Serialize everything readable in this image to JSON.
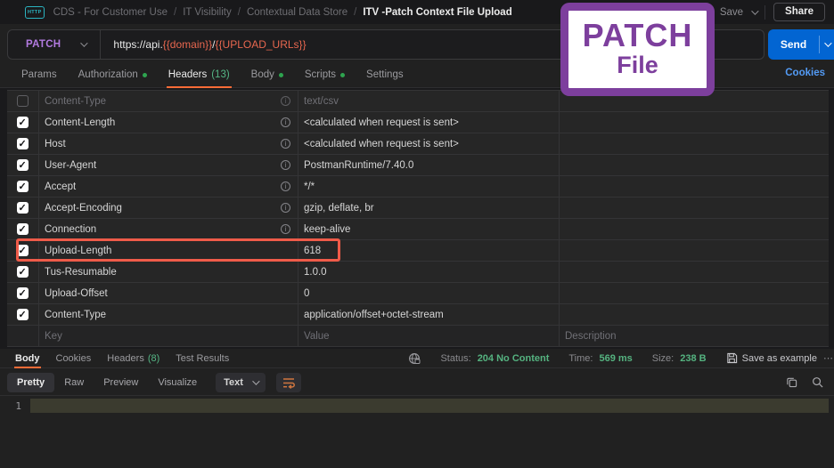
{
  "header": {
    "icon_label": "HTTP",
    "breadcrumb": [
      "CDS - For Customer Use",
      "IT Visibility",
      "Contextual Data Store",
      "ITV -Patch Context File Upload"
    ],
    "separator": "/",
    "save_label": "Save",
    "share_label": "Share"
  },
  "request": {
    "method": "PATCH",
    "url_parts": {
      "p0": "https://api.",
      "p1": "{{domain}}",
      "p2": "/",
      "p3": "{{UPLOAD_URLs}}"
    },
    "send_label": "Send"
  },
  "overlay": {
    "line1": "PATCH",
    "line2": "File"
  },
  "request_tabs": {
    "items": [
      {
        "label": "Params"
      },
      {
        "label": "Authorization"
      },
      {
        "label": "Headers",
        "count": "(13)"
      },
      {
        "label": "Body"
      },
      {
        "label": "Scripts"
      },
      {
        "label": "Settings"
      }
    ],
    "cookies_link": "Cookies"
  },
  "headers_table": {
    "info_glyph": "i",
    "rows": [
      {
        "key": "Content-Type",
        "value": "text/csv",
        "checked": false,
        "info": true,
        "dim": true
      },
      {
        "key": "Content-Length",
        "value": "<calculated when request is sent>",
        "checked": true,
        "info": true
      },
      {
        "key": "Host",
        "value": "<calculated when request is sent>",
        "checked": true,
        "info": true
      },
      {
        "key": "User-Agent",
        "value": "PostmanRuntime/7.40.0",
        "checked": true,
        "info": true
      },
      {
        "key": "Accept",
        "value": "*/*",
        "checked": true,
        "info": true
      },
      {
        "key": "Accept-Encoding",
        "value": "gzip, deflate, br",
        "checked": true,
        "info": true
      },
      {
        "key": "Connection",
        "value": "keep-alive",
        "checked": true,
        "info": true
      },
      {
        "key": "Upload-Length",
        "value": "618",
        "checked": true,
        "highlighted": true
      },
      {
        "key": "Tus-Resumable",
        "value": "1.0.0",
        "checked": true
      },
      {
        "key": "Upload-Offset",
        "value": "0",
        "checked": true
      },
      {
        "key": "Content-Type",
        "value": "application/offset+octet-stream",
        "checked": true
      }
    ],
    "placeholder": {
      "key": "Key",
      "value": "Value",
      "description": "Description"
    }
  },
  "response": {
    "tabs": [
      {
        "label": "Body"
      },
      {
        "label": "Cookies"
      },
      {
        "label": "Headers",
        "count": "(8)"
      },
      {
        "label": "Test Results"
      }
    ],
    "status_label": "Status:",
    "status_value": "204 No Content",
    "time_label": "Time:",
    "time_value": "569 ms",
    "size_label": "Size:",
    "size_value": "238 B",
    "save_as_example": "Save as example",
    "more": "⋯",
    "view_tabs": {
      "pretty": "Pretty",
      "raw": "Raw",
      "preview": "Preview",
      "visualize": "Visualize"
    },
    "format_selected": "Text",
    "line_number": "1"
  },
  "colors": {
    "accent_orange": "#ff6c37",
    "send_blue": "#0265d2",
    "method_purple": "#b27ae0",
    "overlay_purple": "#7d3f9d",
    "status_green": "#55b380",
    "variable_orange": "#e8674f",
    "highlight_red": "#ef5b49"
  }
}
